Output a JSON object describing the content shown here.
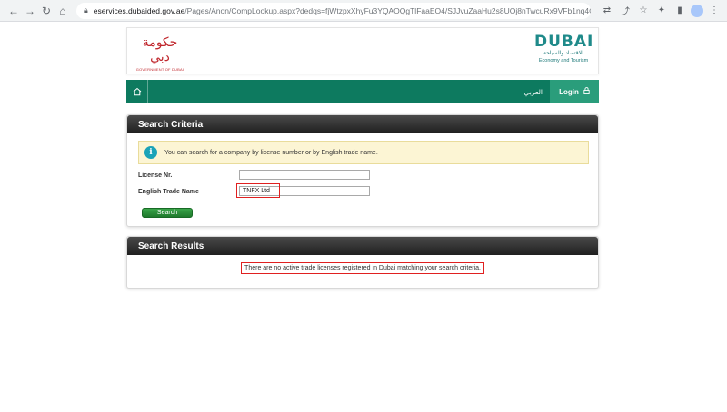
{
  "browser": {
    "url_host": "eservices.dubaided.gov.ae",
    "url_path": "/Pages/Anon/CompLookup.aspx?dedqs=fjWtzpxXhyFu3YQAOQgTlFaaEO4/SJJvuZaaHu2s8UOj8nTwcuRx9VFb1nq4GQ+yzYR..."
  },
  "header": {
    "gov_logo_calligraphy": "حكومة دبي",
    "gov_logo_caption": "GOVERNMENT OF DUBAI",
    "det_logo_word": "DUBAI",
    "det_logo_arabic": "للاقتصاد والسياحة",
    "det_logo_english": "Economy and Tourism"
  },
  "navbar": {
    "lang_label": "العربي",
    "login_label": "Login"
  },
  "search_criteria": {
    "title": "Search Criteria",
    "notice": "You can search for a company by license number or by English trade name.",
    "license_label": "License Nr.",
    "license_value": "",
    "trade_name_label": "English Trade Name",
    "trade_name_value": "TNFX Ltd",
    "search_button": "Search"
  },
  "search_results": {
    "title": "Search Results",
    "message": "There are no active trade licenses registered in Dubai matching your search criteria."
  },
  "colors": {
    "nav_green": "#0d7a5f",
    "login_green": "#2a9d7b",
    "highlight_red": "#e02020"
  }
}
